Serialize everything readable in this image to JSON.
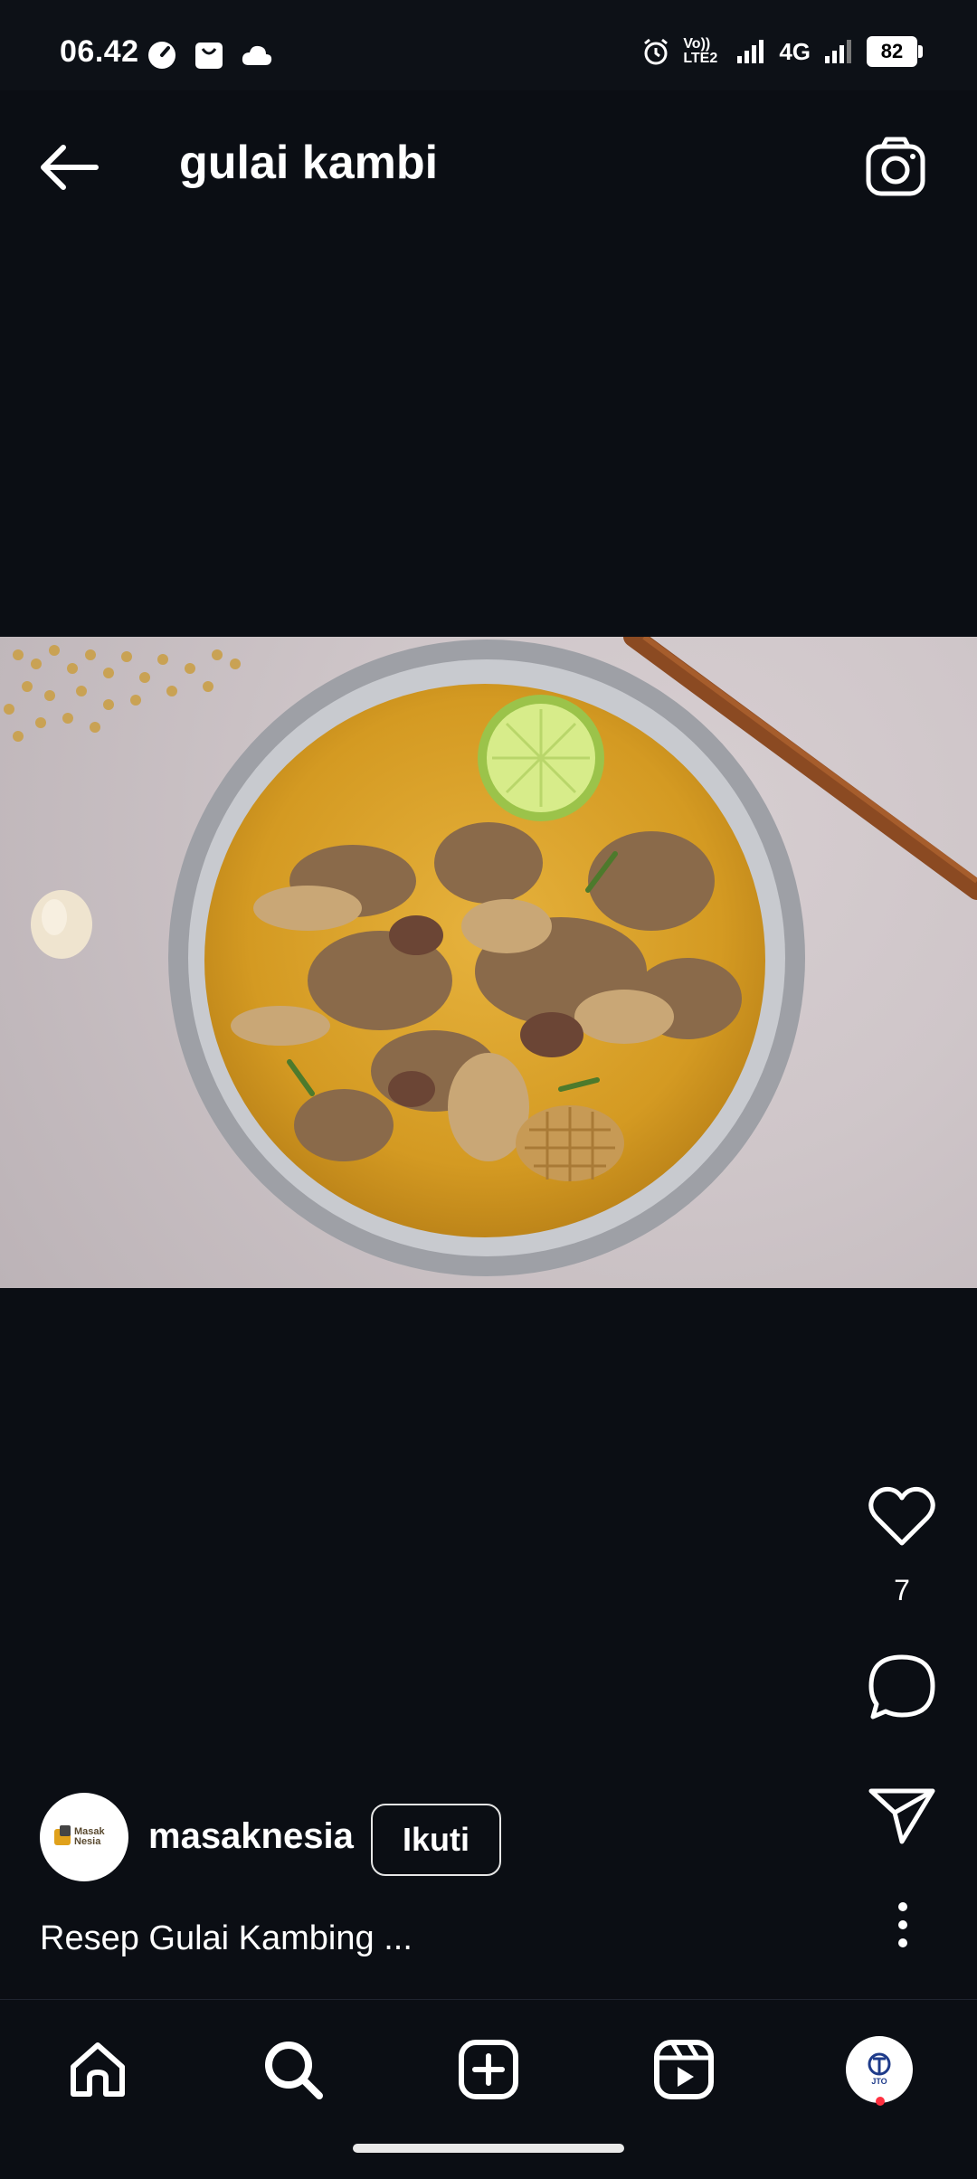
{
  "status_bar": {
    "time": "06.42",
    "network": "4G",
    "volte": "Vo)) LTE2",
    "battery": "82"
  },
  "header": {
    "title": "gulai kambi"
  },
  "post": {
    "like_count": "7",
    "username": "masaknesia",
    "avatar_logo_text": "Masak Nesia",
    "follow_label": "Ikuti",
    "caption": "Resep Gulai Kambing ..."
  },
  "profile_tab": {
    "logo_text": "JTO"
  },
  "colors": {
    "background": "#0b0e14",
    "text": "#ffffff",
    "notification_dot": "#ff3040",
    "curry": "#d9a22a"
  }
}
